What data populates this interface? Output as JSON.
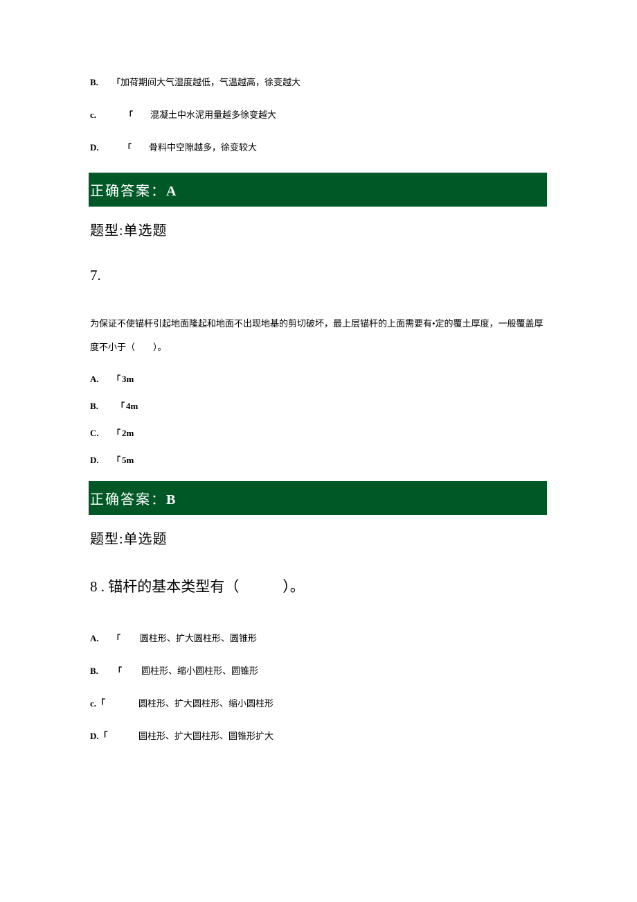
{
  "q6": {
    "options": {
      "B": {
        "letter": "B.",
        "mark": "「",
        "text": "加荷期间大气湿度越低，气温越高，徐变越大"
      },
      "C": {
        "letter": "c.",
        "mark": "「",
        "text": "混凝土中水泥用量越多徐变越大"
      },
      "D": {
        "letter": "D.",
        "mark": "「",
        "text": "骨料中空隙越多，徐变较大"
      }
    },
    "answer_label": "正确答案：",
    "answer_value": "A"
  },
  "qtype_label": "题型:单选题",
  "q7": {
    "number": "7.",
    "stem": "为保证不使锚杆引起地面隆起和地面不出现地基的剪切破坏，最上层锚杆的上面需要有•定的覆土厚度，一般覆盖厚度不小于（　　）。",
    "options": {
      "A": {
        "letter": "A.",
        "mark": "「",
        "text": "3m"
      },
      "B": {
        "letter": "B.",
        "mark": "「",
        "text": "4m"
      },
      "C": {
        "letter": "C.",
        "mark": "「",
        "text": "2m"
      },
      "D": {
        "letter": "D.",
        "mark": "「",
        "text": "5m"
      }
    },
    "answer_label": "正确答案：",
    "answer_value": "B"
  },
  "q8": {
    "number": "8",
    "title_sep": " . ",
    "title": "锚杆的基本类型有（　　　）。",
    "options": {
      "A": {
        "letter": "A.",
        "mark": "「",
        "text": "圆柱形、扩大圆柱形、圆锥形"
      },
      "B": {
        "letter": "B.",
        "mark": "「",
        "text": "圆柱形、缩小圆柱形、圆锥形"
      },
      "C": {
        "letter": "c.「",
        "mark": "",
        "text": "圆柱形、扩大圆柱形、缩小圆柱形"
      },
      "D": {
        "letter": "D.「",
        "mark": "",
        "text": "圆柱形、扩大圆柱形、圆锥形扩大"
      }
    }
  }
}
